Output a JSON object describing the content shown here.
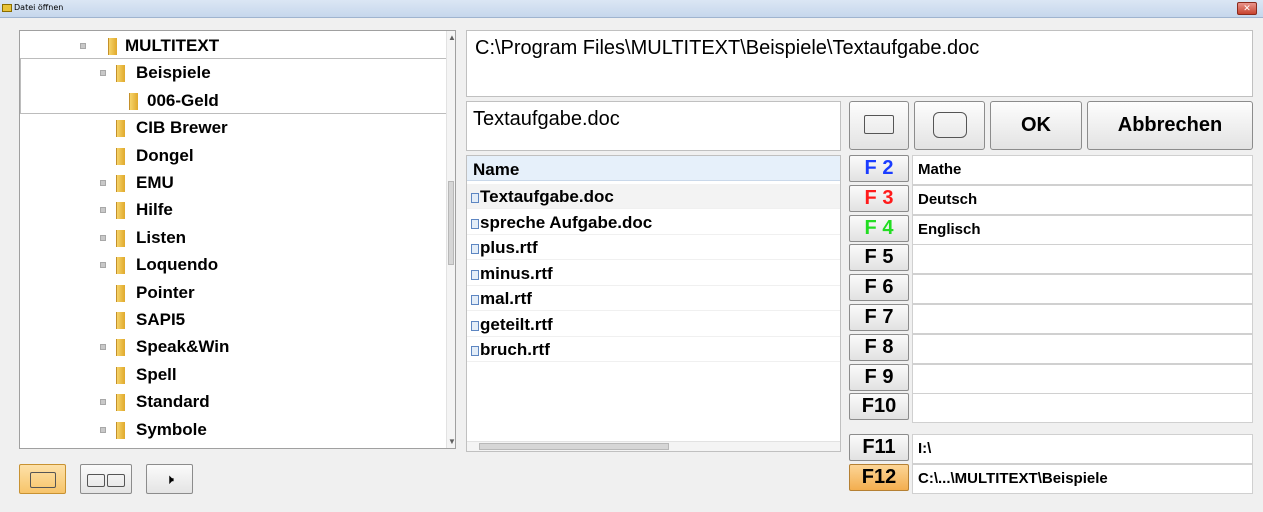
{
  "window": {
    "title": "Datei öffnen",
    "close_glyph": "✕"
  },
  "tree": {
    "items": [
      {
        "label": "MULTITEXT",
        "expander": true,
        "level": 0
      },
      {
        "label": "Beispiele",
        "expander": true,
        "level": 1
      },
      {
        "label": "006-Geld",
        "expander": false,
        "level": 2
      },
      {
        "label": "CIB Brewer",
        "expander": false,
        "level": 1
      },
      {
        "label": "Dongel",
        "expander": false,
        "level": 1
      },
      {
        "label": "EMU",
        "expander": true,
        "level": 1
      },
      {
        "label": "Hilfe",
        "expander": true,
        "level": 1
      },
      {
        "label": "Listen",
        "expander": true,
        "level": 1
      },
      {
        "label": "Loquendo",
        "expander": true,
        "level": 1
      },
      {
        "label": "Pointer",
        "expander": false,
        "level": 1
      },
      {
        "label": "SAPI5",
        "expander": false,
        "level": 1
      },
      {
        "label": "Speak&Win",
        "expander": true,
        "level": 1
      },
      {
        "label": "Spell",
        "expander": false,
        "level": 1
      },
      {
        "label": "Standard",
        "expander": true,
        "level": 1
      },
      {
        "label": "Symbole",
        "expander": true,
        "level": 1
      }
    ]
  },
  "path": "C:\\Program Files\\MULTITEXT\\Beispiele\\Textaufgabe.doc",
  "filename": "Textaufgabe.doc",
  "filelist": {
    "header": "Name",
    "files": [
      "Textaufgabe.doc",
      "spreche Aufgabe.doc",
      "plus.rtf",
      "minus.rtf",
      "mal.rtf",
      "geteilt.rtf",
      "bruch.rtf"
    ]
  },
  "buttons": {
    "ok": "OK",
    "cancel": "Abbrechen"
  },
  "fkeys": [
    {
      "key": "F 2",
      "value": "Mathe",
      "color": "#1a3cff"
    },
    {
      "key": "F 3",
      "value": "Deutsch",
      "color": "#ff1a1a"
    },
    {
      "key": "F 4",
      "value": "Englisch",
      "color": "#22dd22"
    },
    {
      "key": "F 5",
      "value": "",
      "color": "#000000"
    },
    {
      "key": "F 6",
      "value": "",
      "color": "#000000"
    },
    {
      "key": "F 7",
      "value": "",
      "color": "#000000"
    },
    {
      "key": "F 8",
      "value": "",
      "color": "#000000"
    },
    {
      "key": "F 9",
      "value": "",
      "color": "#000000"
    },
    {
      "key": "F10",
      "value": "",
      "color": "#000000"
    }
  ],
  "drives": [
    {
      "key": "F11",
      "value": "I:\\"
    },
    {
      "key": "F12",
      "value": "C:\\...\\MULTITEXT\\Beispiele"
    }
  ],
  "toolbar": {
    "speaker_glyph": "🕨"
  },
  "colors": {
    "accent_orange": "#f7c46a",
    "selection_blue": "#e6f0fa"
  }
}
